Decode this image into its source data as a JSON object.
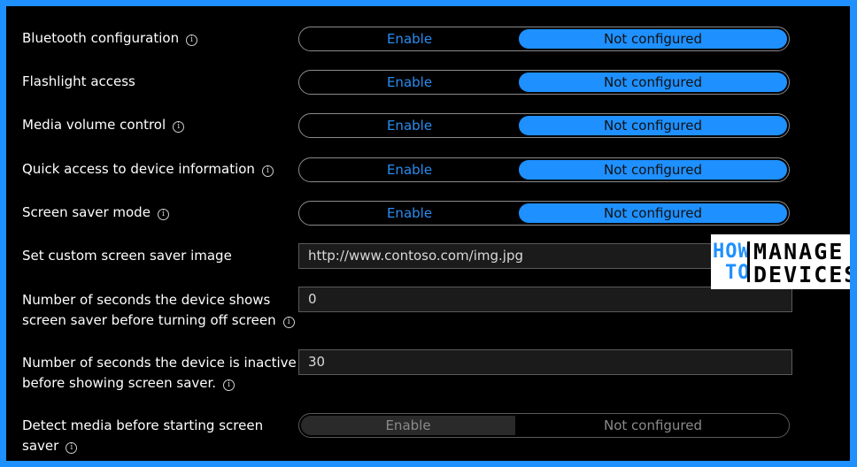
{
  "settings": [
    {
      "label": "Bluetooth configuration",
      "enable": "Enable",
      "not_configured": "Not configured"
    },
    {
      "label": "Flashlight access",
      "enable": "Enable",
      "not_configured": "Not configured"
    },
    {
      "label": "Media volume control",
      "enable": "Enable",
      "not_configured": "Not configured"
    },
    {
      "label": "Quick access to device information",
      "enable": "Enable",
      "not_configured": "Not configured"
    },
    {
      "label": "Screen saver mode",
      "enable": "Enable",
      "not_configured": "Not configured"
    }
  ],
  "custom_image": {
    "label": "Set custom screen saver image",
    "value": "http://www.contoso.com/img.jpg"
  },
  "seconds_off": {
    "label_line1": "Number of seconds the device shows",
    "label_line2": "screen saver before turning off screen",
    "value": "0"
  },
  "seconds_inactive": {
    "label_line1": "Number of seconds the device is inactive",
    "label_line2": "before showing screen saver.",
    "value": "30"
  },
  "detect_media": {
    "label_line1": "Detect media before starting screen",
    "label_line2": "saver",
    "enable": "Enable",
    "not_configured": "Not configured"
  },
  "info_glyph": "i",
  "logo": {
    "how": "HOW",
    "to": "TO",
    "manage": "MANAGE",
    "devices": "DEVICES"
  },
  "colors": {
    "accent": "#1e90ff",
    "background": "#000000",
    "text": "#ffffff",
    "enable_text": "#2a8cf0"
  }
}
